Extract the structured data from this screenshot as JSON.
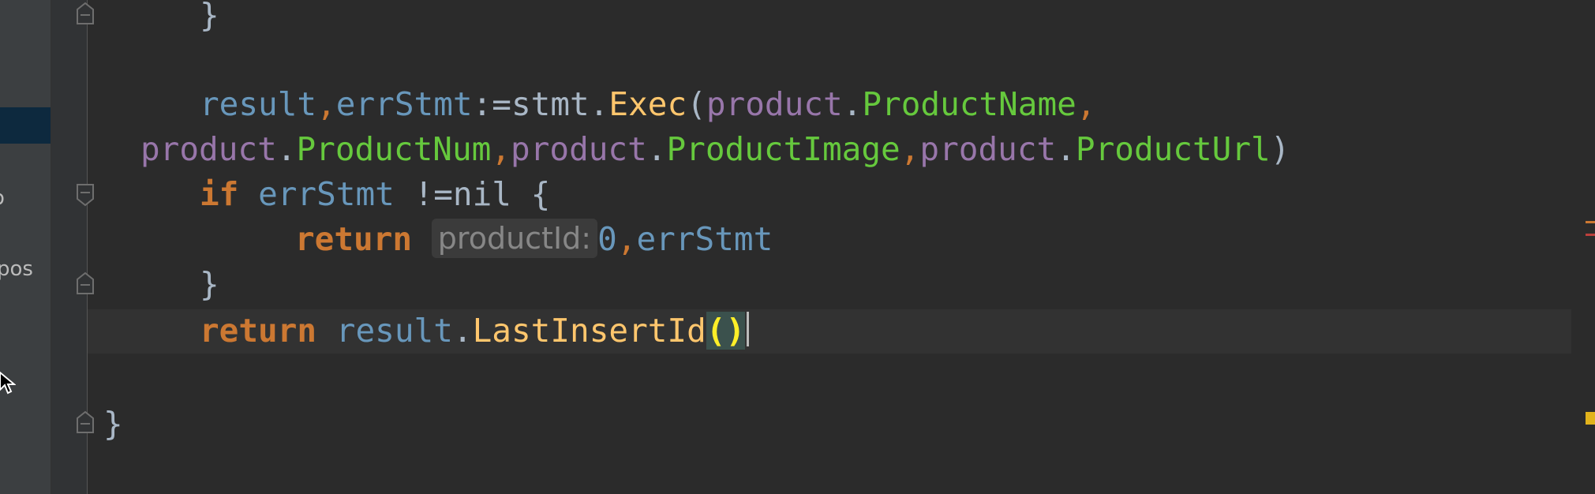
{
  "sidebar": {
    "fragment_1": "o",
    "fragment_2": "pos"
  },
  "code": {
    "line_1": {
      "brace": "}"
    },
    "line_2": {
      "result": "result",
      "comma1": ",",
      "errStmt": "errStmt",
      "assign": ":=",
      "stmt": "stmt",
      "dot": ".",
      "exec": "Exec",
      "open": "(",
      "product": "product",
      "field": "ProductName",
      "comma2": ","
    },
    "line_3": {
      "product1": "product",
      "field1": "ProductNum",
      "product2": "product",
      "field2": "ProductImage",
      "product3": "product",
      "field3": "ProductUrl",
      "close": ")"
    },
    "line_4": {
      "if": "if",
      "errStmt": "errStmt",
      "neq": "!=nil",
      "brace": "{"
    },
    "line_5": {
      "return": "return",
      "hint": "productId:",
      "zero": "0",
      "comma": ",",
      "errStmt": "errStmt"
    },
    "line_6": {
      "brace": "}"
    },
    "line_7": {
      "return": "return",
      "result": "result",
      "dot": ".",
      "fn": "LastInsertId",
      "parens": "()"
    },
    "line_9": {
      "brace": "}"
    }
  },
  "colors": {
    "background": "#2b2b2b",
    "keyword": "#cc7832",
    "variable": "#6897bb",
    "field_owner": "#9876aa",
    "property": "#66c93d",
    "function": "#ffc66d"
  }
}
